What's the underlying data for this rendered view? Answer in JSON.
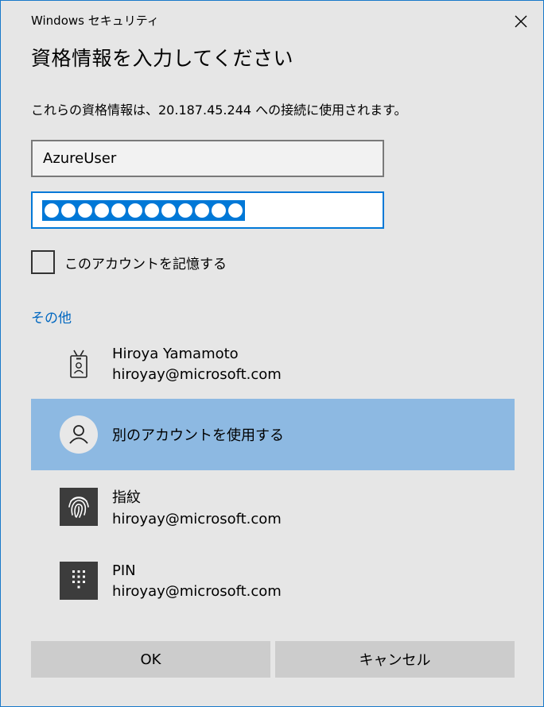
{
  "window": {
    "app_title": "Windows セキュリティ",
    "heading": "資格情報を入力してください",
    "description": "これらの資格情報は、20.187.45.244 への接続に使用されます。"
  },
  "form": {
    "username_value": "AzureUser",
    "password_mask": "●●●●●●●●●●●●",
    "password_length": 12,
    "remember_label": "このアカウントを記憶する",
    "remember_checked": false
  },
  "other": {
    "link_label": "その他",
    "accounts": [
      {
        "icon": "badge-icon",
        "name": "Hiroya Yamamoto",
        "email": "hiroyay@microsoft.com"
      },
      {
        "icon": "person-icon",
        "name": "別のアカウントを使用する",
        "selected": true
      },
      {
        "icon": "fingerprint-icon",
        "name": "指紋",
        "email": "hiroyay@microsoft.com"
      },
      {
        "icon": "pin-keypad-icon",
        "name": "PIN",
        "email": "hiroyay@microsoft.com"
      }
    ]
  },
  "buttons": {
    "ok_label": "OK",
    "cancel_label": "キャンセル"
  },
  "colors": {
    "background": "#e6e6e6",
    "accent": "#0078d7",
    "link": "#0067c0",
    "selected_row": "#8db9e2",
    "button": "#cccccc",
    "icon_tile": "#3c3c3c"
  }
}
